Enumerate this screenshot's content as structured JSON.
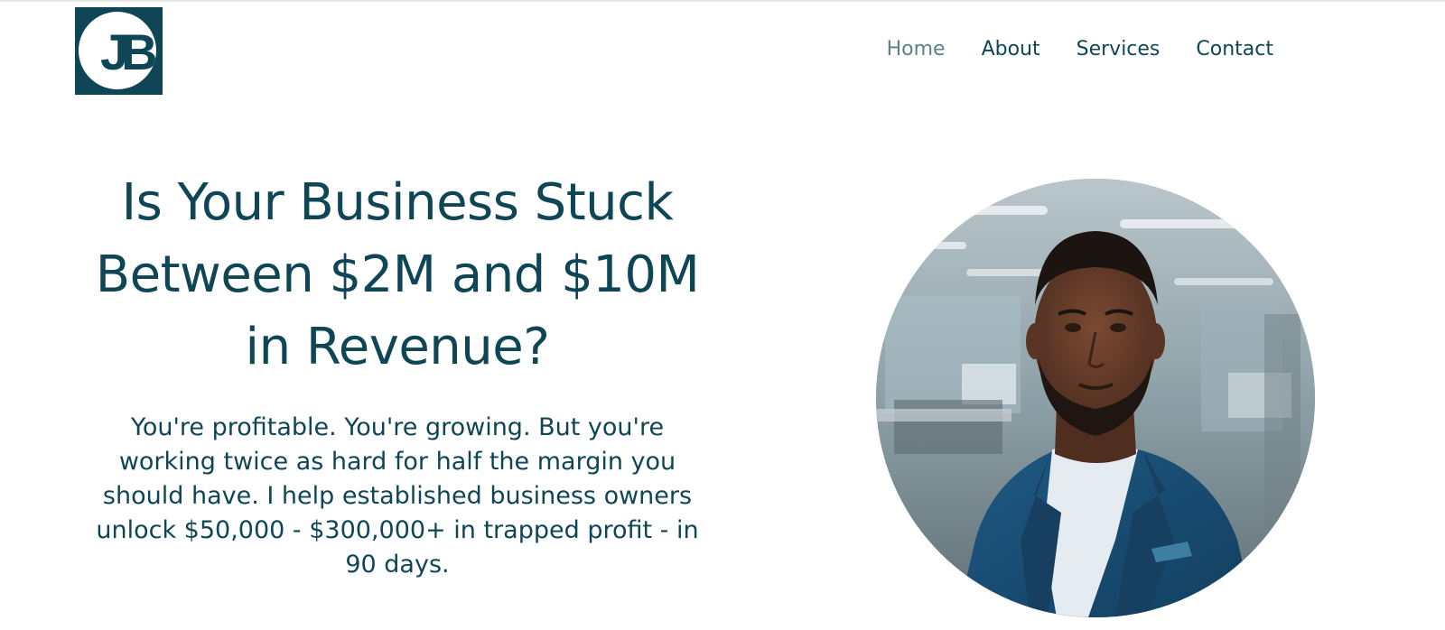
{
  "brand": {
    "logo_text": "JB",
    "primary_color": "#0f4656",
    "nav_active_color": "#5a8288"
  },
  "nav": {
    "items": [
      {
        "label": "Home",
        "active": true
      },
      {
        "label": "About",
        "active": false
      },
      {
        "label": "Services",
        "active": false
      },
      {
        "label": "Contact",
        "active": false
      }
    ]
  },
  "hero": {
    "title_line1": "Is Your Business Stuck",
    "title_line2": "Between $2M and $10M",
    "title_line3": "in Revenue?",
    "subtitle": "You're profitable. You're growing. But you're working twice as hard for half the margin you should have. I help established business owners unlock $50,000 - $300,000+ in trapped profit - in 90 days."
  },
  "portrait": {
    "description_icon": "professional-portrait-photo"
  }
}
